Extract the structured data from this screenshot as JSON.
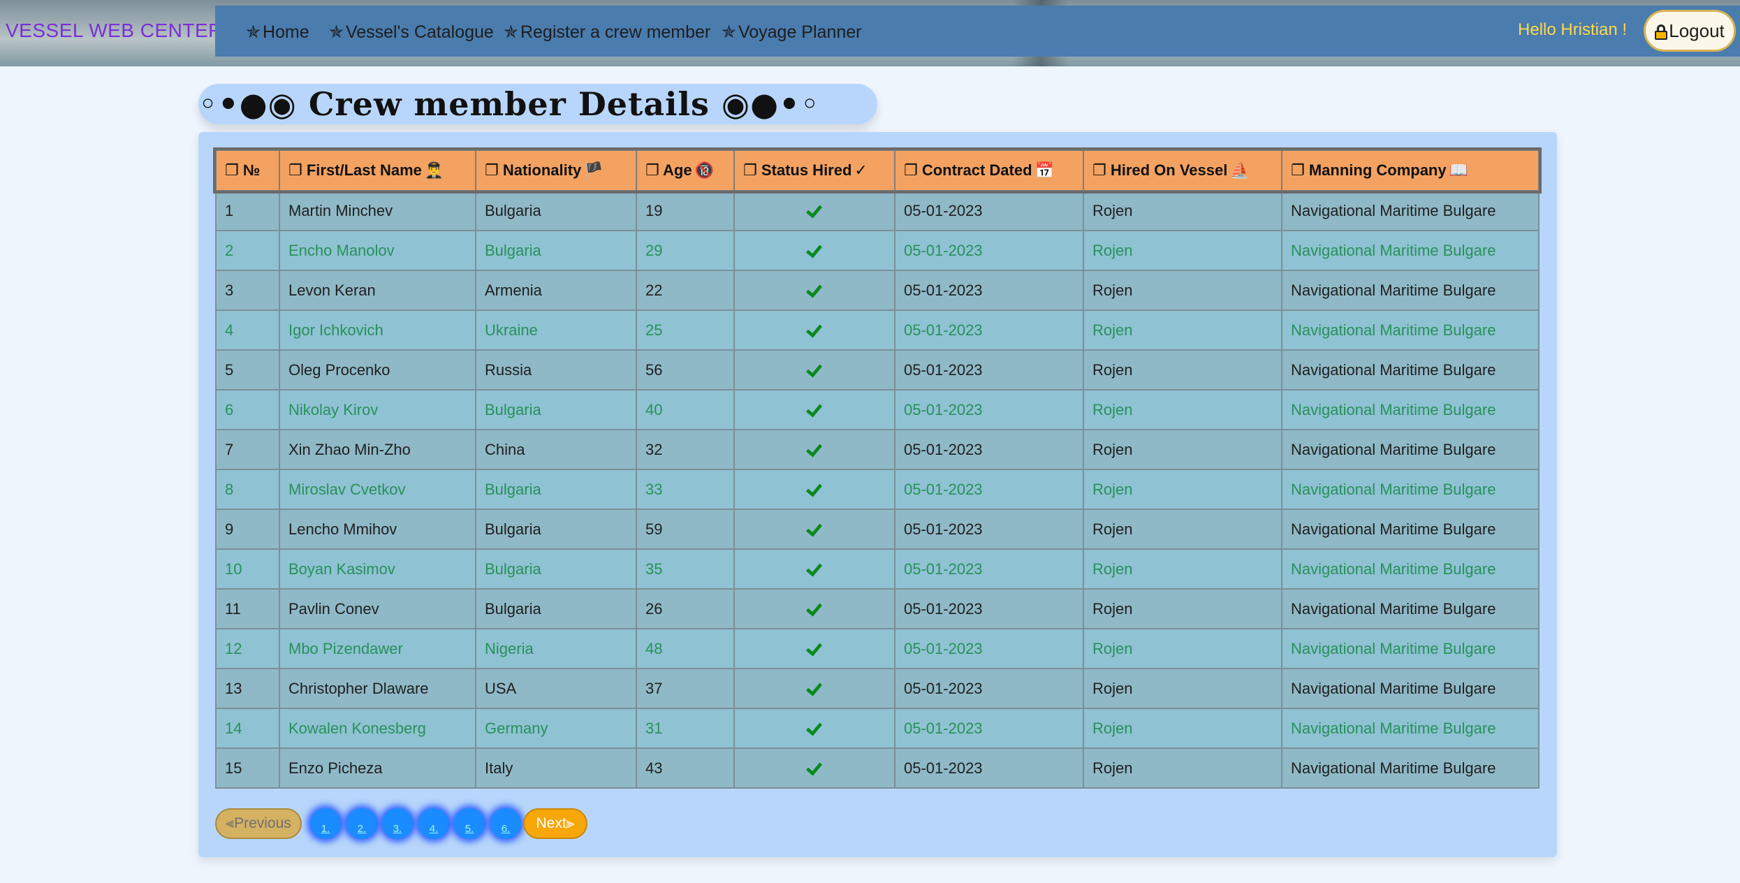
{
  "header": {
    "brand": "VESSEL WEB CENTER",
    "nav": [
      {
        "label": "Home"
      },
      {
        "label": "Vessel's Catalogue"
      },
      {
        "label": "Register a crew member"
      },
      {
        "label": "Voyage Planner"
      }
    ],
    "nav_star": "✯",
    "greeting": "Hello Hristian !",
    "logout_label": "Logout"
  },
  "page_title": "◦•●◉ Crew member Details ◉●•◦",
  "table": {
    "columns": [
      {
        "label": "❐ №",
        "icon": ""
      },
      {
        "label": "❐ First/Last Name",
        "icon": "👨‍✈️"
      },
      {
        "label": "❐ Nationality",
        "icon": "🏴"
      },
      {
        "label": "❐ Age",
        "icon": "🔞"
      },
      {
        "label": "❐ Status Hired",
        "icon": "✓"
      },
      {
        "label": "❐ Contract Dated",
        "icon": "📅"
      },
      {
        "label": "❐ Hired On Vessel",
        "icon": "⛵"
      },
      {
        "label": "❐ Manning Company",
        "icon": "📖"
      }
    ],
    "rows": [
      {
        "no": "1",
        "name": "Martin Minchev",
        "nationality": "Bulgaria",
        "age": "19",
        "date": "05-01-2023",
        "vessel": "Rojen",
        "company": "Navigational Maritime Bulgare"
      },
      {
        "no": "2",
        "name": "Encho Manolov",
        "nationality": "Bulgaria",
        "age": "29",
        "date": "05-01-2023",
        "vessel": "Rojen",
        "company": "Navigational Maritime Bulgare"
      },
      {
        "no": "3",
        "name": "Levon Keran",
        "nationality": "Armenia",
        "age": "22",
        "date": "05-01-2023",
        "vessel": "Rojen",
        "company": "Navigational Maritime Bulgare"
      },
      {
        "no": "4",
        "name": "Igor Ichkovich",
        "nationality": "Ukraine",
        "age": "25",
        "date": "05-01-2023",
        "vessel": "Rojen",
        "company": "Navigational Maritime Bulgare"
      },
      {
        "no": "5",
        "name": "Oleg Procenko",
        "nationality": "Russia",
        "age": "56",
        "date": "05-01-2023",
        "vessel": "Rojen",
        "company": "Navigational Maritime Bulgare"
      },
      {
        "no": "6",
        "name": "Nikolay Kirov",
        "nationality": "Bulgaria",
        "age": "40",
        "date": "05-01-2023",
        "vessel": "Rojen",
        "company": "Navigational Maritime Bulgare"
      },
      {
        "no": "7",
        "name": "Xin Zhao Min-Zho",
        "nationality": "China",
        "age": "32",
        "date": "05-01-2023",
        "vessel": "Rojen",
        "company": "Navigational Maritime Bulgare"
      },
      {
        "no": "8",
        "name": "Miroslav Cvetkov",
        "nationality": "Bulgaria",
        "age": "33",
        "date": "05-01-2023",
        "vessel": "Rojen",
        "company": "Navigational Maritime Bulgare"
      },
      {
        "no": "9",
        "name": "Lencho Mmihov",
        "nationality": "Bulgaria",
        "age": "59",
        "date": "05-01-2023",
        "vessel": "Rojen",
        "company": "Navigational Maritime Bulgare"
      },
      {
        "no": "10",
        "name": "Boyan Kasimov",
        "nationality": "Bulgaria",
        "age": "35",
        "date": "05-01-2023",
        "vessel": "Rojen",
        "company": "Navigational Maritime Bulgare"
      },
      {
        "no": "11",
        "name": "Pavlin Conev",
        "nationality": "Bulgaria",
        "age": "26",
        "date": "05-01-2023",
        "vessel": "Rojen",
        "company": "Navigational Maritime Bulgare"
      },
      {
        "no": "12",
        "name": "Mbo Pizendawer",
        "nationality": "Nigeria",
        "age": "48",
        "date": "05-01-2023",
        "vessel": "Rojen",
        "company": "Navigational Maritime Bulgare"
      },
      {
        "no": "13",
        "name": "Christopher Dlaware",
        "nationality": "USA",
        "age": "37",
        "date": "05-01-2023",
        "vessel": "Rojen",
        "company": "Navigational Maritime Bulgare"
      },
      {
        "no": "14",
        "name": "Kowalen Konesberg",
        "nationality": "Germany",
        "age": "31",
        "date": "05-01-2023",
        "vessel": "Rojen",
        "company": "Navigational Maritime Bulgare"
      },
      {
        "no": "15",
        "name": "Enzo Picheza",
        "nationality": "Italy",
        "age": "43",
        "date": "05-01-2023",
        "vessel": "Rojen",
        "company": "Navigational Maritime Bulgare"
      }
    ],
    "status_icon": "check-icon"
  },
  "pagination": {
    "prev_label": "⫷Previous",
    "next_label": "Next⫸",
    "pages": [
      "1.",
      "2.",
      "3.",
      "4.",
      "5.",
      "6."
    ]
  },
  "colors": {
    "navbar": "#4a7cae",
    "brand": "#7b2fd6",
    "greeting": "#ffd84a",
    "header_row": "#f4a261",
    "row_odd": "#8fb9c7",
    "row_even": "#8fc2d3",
    "even_text": "#27915a",
    "check": "#0a8a1f",
    "page_button": "#1a8cff",
    "next_button": "#f7a70a"
  }
}
